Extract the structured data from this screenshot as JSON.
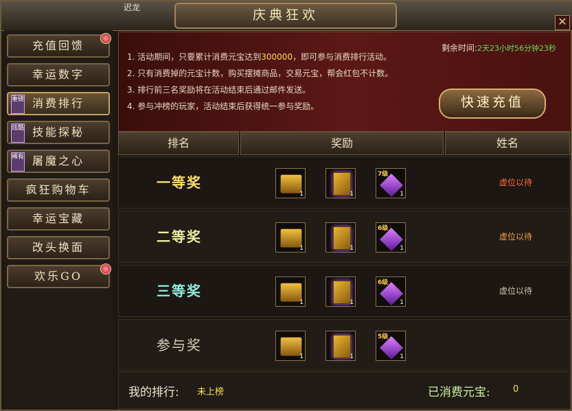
{
  "window": {
    "player_name": "迟龙",
    "title": "庆典狂欢",
    "close_symbol": "✕"
  },
  "sidebar": {
    "items": [
      {
        "label": "充值回馈",
        "badge": "",
        "dot": true
      },
      {
        "label": "幸运数字",
        "badge": "",
        "dot": false
      },
      {
        "label": "消费排行",
        "badge": "重磅",
        "dot": false,
        "active": true
      },
      {
        "label": "技能探秘",
        "badge": "炫酷",
        "dot": false
      },
      {
        "label": "屠魔之心",
        "badge": "稀有",
        "dot": false
      },
      {
        "label": "疯狂购物车",
        "badge": "",
        "dot": false
      },
      {
        "label": "幸运宝藏",
        "badge": "",
        "dot": false
      },
      {
        "label": "改头换面",
        "badge": "",
        "dot": false
      },
      {
        "label": "欢乐GO",
        "badge": "",
        "dot": true
      }
    ]
  },
  "banner": {
    "rules": [
      {
        "pre": "1. 活动期间，只要累计消费元宝达到",
        "hl": "300000",
        "post": "，即可参与消费排行活动。"
      },
      {
        "pre": "2. 只有消费掉的元宝计数，购买摆摊商品，交易元宝，帮会红包不计数。",
        "hl": "",
        "post": ""
      },
      {
        "pre": "3. 排行前三名奖励将在活动结束后通过邮件发送。",
        "hl": "",
        "post": ""
      },
      {
        "pre": "4. 参与冲榜的玩家，活动结束后获得统一参与奖励。",
        "hl": "",
        "post": ""
      }
    ],
    "countdown_label": "剩余时间:",
    "countdown_value": "2天23小时56分钟23秒",
    "recharge_label": "快速充值"
  },
  "table": {
    "headers": {
      "rank": "排名",
      "reward": "奖励",
      "name": "姓名"
    },
    "rows": [
      {
        "rank": "一等奖",
        "name": "虚位以待",
        "name_color": "#ff6a3a",
        "items": [
          {
            "kind": "chest",
            "count": "1",
            "level": ""
          },
          {
            "kind": "book",
            "count": "1",
            "level": ""
          },
          {
            "kind": "gem",
            "count": "1",
            "level": "7级"
          }
        ]
      },
      {
        "rank": "二等奖",
        "name": "虚位以待",
        "name_color": "#f0a040",
        "items": [
          {
            "kind": "chest",
            "count": "1",
            "level": ""
          },
          {
            "kind": "book",
            "count": "1",
            "level": ""
          },
          {
            "kind": "gem",
            "count": "1",
            "level": "6级"
          }
        ]
      },
      {
        "rank": "三等奖",
        "name": "虚位以待",
        "name_color": "#c8c0b0",
        "items": [
          {
            "kind": "chest",
            "count": "1",
            "level": ""
          },
          {
            "kind": "book",
            "count": "1",
            "level": ""
          },
          {
            "kind": "gem",
            "count": "1",
            "level": "6级"
          }
        ]
      },
      {
        "rank": "参与奖",
        "name": "",
        "name_color": "#c8c0b0",
        "items": [
          {
            "kind": "chest",
            "count": "1",
            "level": ""
          },
          {
            "kind": "book",
            "count": "1",
            "level": ""
          },
          {
            "kind": "gem",
            "count": "1",
            "level": "5级"
          }
        ]
      }
    ]
  },
  "footer": {
    "my_rank_label": "我的排行:",
    "my_rank_value": "未上榜",
    "spent_label": "已消费元宝:",
    "spent_value": "0"
  }
}
